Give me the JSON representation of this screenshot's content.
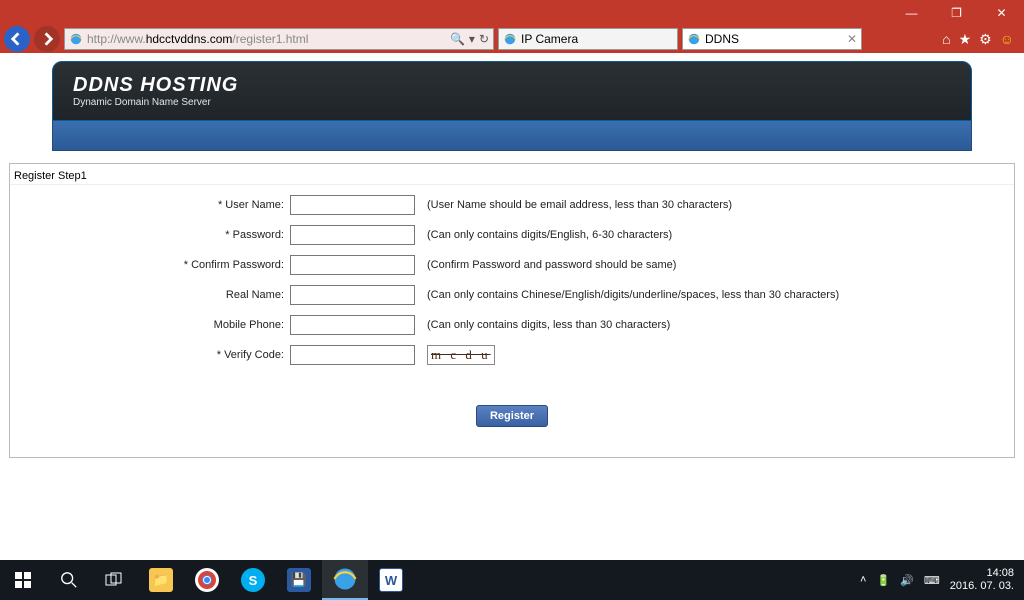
{
  "window": {
    "minimize": "—",
    "maximize": "❐",
    "close": "✕"
  },
  "browser": {
    "url_prefix": "http://www.",
    "url_domain": "hdcctvddns.com",
    "url_path": "/register1.html",
    "search_icon": "🔍",
    "refresh_icon": "↻",
    "dropdown": "▾",
    "tabs": [
      {
        "label": "IP Camera",
        "active": false
      },
      {
        "label": "DDNS",
        "active": true
      }
    ],
    "tools": {
      "home": "⌂",
      "star": "★",
      "gear": "⚙",
      "smile": "☺"
    }
  },
  "header": {
    "title": "DDNS HOSTING",
    "subtitle": "Dynamic Domain Name Server"
  },
  "form": {
    "panel_title": "Register Step1",
    "fields": [
      {
        "label": "* User Name:",
        "hint": "(User Name should be email address, less than 30 characters)"
      },
      {
        "label": "* Password:",
        "hint": "(Can only contains digits/English, 6-30 characters)"
      },
      {
        "label": "* Confirm Password:",
        "hint": "(Confirm Password and password should be same)"
      },
      {
        "label": "Real Name:",
        "hint": "(Can only contains Chinese/English/digits/underline/spaces, less than 30 characters)"
      },
      {
        "label": "Mobile Phone:",
        "hint": "(Can only contains digits, less than 30 characters)"
      },
      {
        "label": "* Verify Code:",
        "captcha": "m c d u"
      }
    ],
    "register_label": "Register"
  },
  "taskbar": {
    "clock_time": "14:08",
    "clock_date": "2016. 07. 03."
  }
}
